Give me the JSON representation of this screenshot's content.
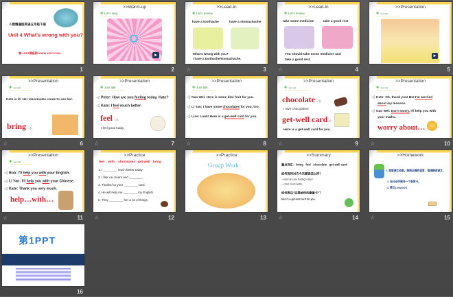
{
  "slides": [
    {
      "number": "1",
      "header": "人教精通版英语五年级下册",
      "title": "Unit 4 What's wrong with you?",
      "footer": "第一PPT模板网-WWW.1PPT.COM"
    },
    {
      "number": "2",
      "section": ">>Warm-up",
      "tag": "Let's sing",
      "letter": "O"
    },
    {
      "number": "3",
      "section": ">>Lead-in",
      "tag": "Let's review",
      "phrase1": "have a toothache",
      "phrase2": "have a stomachache",
      "line1": "What's wrong with you?",
      "line2": "I have a toothache/stomachache."
    },
    {
      "number": "4",
      "section": ">>Lead-in",
      "tag": "Let's review",
      "phrase1": "take some medicine",
      "phrase2": "take a good rest",
      "line1": "You should take some medicine and",
      "line2": "take a good rest."
    },
    {
      "number": "5",
      "section": ">>Presentation",
      "tag": "Just talk"
    },
    {
      "number": "6",
      "section": ">>Presentation",
      "tag": "Just talk",
      "line1": "Kate is ill. Her classmates come to see her.",
      "word": "bring"
    },
    {
      "number": "7",
      "section": ">>Presentation",
      "tag": "Just talk",
      "line1a": "Peter: How are you ",
      "line1u": "feeling",
      "line1b": " today, Kate?",
      "line2a": "Kate: I ",
      "line2u": "feel",
      "line2b": " much better.",
      "word": "feel",
      "example": "I feel good today."
    },
    {
      "number": "8",
      "section": ">>Presentation",
      "tag": "Just talk",
      "line1": "Gao Wei: Here is some kiwi fruit for you.",
      "line2a": "Li Yan: I have some ",
      "line2u": "chocolates",
      "line2b": " for you, too.",
      "line3a": "Lisa: Look! Here is a ",
      "line3u": "get-well card",
      "line3b": " for you."
    },
    {
      "number": "9",
      "section": ">>Presentation",
      "tag": "Just talk",
      "word1": "chocolate",
      "example1": "I love chocolates!",
      "word2": "get-well card",
      "example2": "Here is a get-well card for you."
    },
    {
      "number": "10",
      "section": ">>Presentation",
      "tag": "Just talk",
      "line1a": "Kate: Oh, thank you! But ",
      "line1u": "I'm worried",
      "line1c": "about",
      "line1b": " my lessons.",
      "line2a": "Gao Wei: ",
      "line2u": "Don't worry.",
      "line2b": " I'll help you with",
      "line2c": "your maths.",
      "word": "worry about…"
    },
    {
      "number": "11",
      "section": ">>Presentation",
      "tag": "Just talk",
      "line1a": "Bob: I'll ",
      "line1u1": "help",
      "line1m": " you ",
      "line1u2": "with",
      "line1b": " your English.",
      "line2a": "Li Yan: I'll ",
      "line2u1": "help",
      "line2m": " you ",
      "line2u2": "with",
      "line2b": " your Chinese.",
      "line3": "Kate: Thank you very much.",
      "word": "help…with…"
    },
    {
      "number": "12",
      "section": ">>Practice",
      "words": "feel    with    chocolates   get-well   bring",
      "items": [
        "1. I ________ much better today.",
        "2. I like ice cream and ________.",
        "3. Thanks for your ________ card.",
        "4. He will help me ________ my English.",
        "5. They ________ her a lot of things."
      ]
    },
    {
      "number": "13",
      "section": ">>Practice",
      "title": "Group Work"
    },
    {
      "number": "14",
      "section": ">>Summary",
      "line1": "重点词汇：bring   feel   chocolate   get-well card",
      "line2": "如何询问对方今天感觉怎么样?",
      "line3": "—How are you feeling today?",
      "line4": "—I feel much better.",
      "line5": "如何表达“这是给你的康复卡”？",
      "line6": "Here's a get-well card for you."
    },
    {
      "number": "15",
      "section": ">>Homework",
      "items": [
        "1. 观看课文动画，按照正确的语音、语调朗读课文。",
        "2. 自己动手制作一个祝贺卡。",
        "3. 预习Lesson24."
      ]
    },
    {
      "number": "16",
      "logo": "第1PPT"
    }
  ],
  "colors": {
    "accent_red": "#d0202a",
    "header_yellow": "#f7d454",
    "tag_green": "#3a8a3a"
  }
}
